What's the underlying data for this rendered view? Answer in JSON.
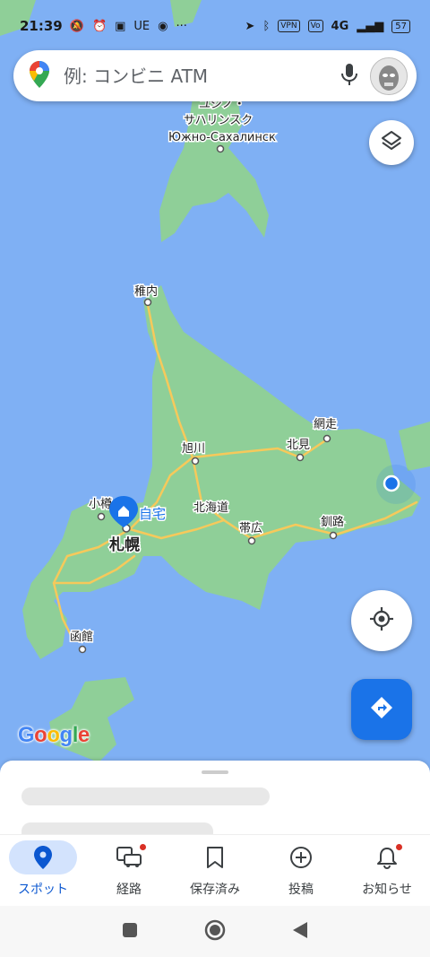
{
  "status_bar": {
    "time": "21:39",
    "left_glyphs": [
      "UE",
      "···"
    ],
    "vpn": "VPN",
    "network": "4G",
    "battery": "57"
  },
  "search": {
    "placeholder": "例: コンビニ ATM"
  },
  "map": {
    "labels": {
      "yuzhno_jp": "ユジノ・",
      "yuzhno_jp2": "サハリンスク",
      "yuzhno_ru": "Южно-Сахалинск",
      "wakkanai": "稚内",
      "abashiri": "網走",
      "kitami": "北見",
      "asahikawa": "旭川",
      "otaru": "小樽",
      "home": "自宅",
      "hokkaido": "北海道",
      "sapporo": "札幌",
      "obihiro": "帯広",
      "kushiro": "釧路",
      "hakodate": "函館"
    },
    "logo": "Google",
    "colors": {
      "sea": "#7fb0f4",
      "land": "#8fcf98",
      "road": "#f6c95b",
      "accent": "#1a73e8"
    }
  },
  "nav": {
    "items": [
      {
        "label": "スポット",
        "icon": "location-pin-icon",
        "active": true
      },
      {
        "label": "経路",
        "icon": "commute-icon",
        "badge": true
      },
      {
        "label": "保存済み",
        "icon": "bookmark-icon"
      },
      {
        "label": "投稿",
        "icon": "add-circle-icon"
      },
      {
        "label": "お知らせ",
        "icon": "bell-icon",
        "badge": true
      }
    ]
  }
}
